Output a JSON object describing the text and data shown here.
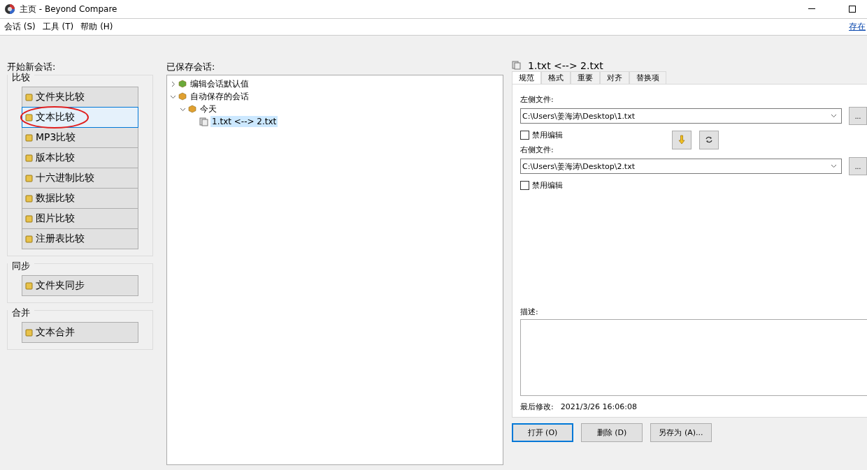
{
  "window": {
    "title": "主页 - Beyond Compare"
  },
  "menu": {
    "items": [
      {
        "label": "会话 (S)"
      },
      {
        "label": "工具 (T)"
      },
      {
        "label": "帮助 (H)"
      }
    ],
    "link": "存在"
  },
  "new_session": {
    "heading": "开始新会话:",
    "groups": [
      {
        "title": "比较",
        "buttons": [
          {
            "label": "文件夹比较",
            "selected": false,
            "circled": false
          },
          {
            "label": "文本比较",
            "selected": true,
            "circled": true
          },
          {
            "label": "MP3比较",
            "selected": false,
            "circled": false
          },
          {
            "label": "版本比较",
            "selected": false,
            "circled": false
          },
          {
            "label": "十六进制比较",
            "selected": false,
            "circled": false
          },
          {
            "label": "数据比较",
            "selected": false,
            "circled": false
          },
          {
            "label": "图片比较",
            "selected": false,
            "circled": false
          },
          {
            "label": "注册表比较",
            "selected": false,
            "circled": false
          }
        ]
      },
      {
        "title": "同步",
        "buttons": [
          {
            "label": "文件夹同步",
            "selected": false,
            "circled": false
          }
        ]
      },
      {
        "title": "合并",
        "buttons": [
          {
            "label": "文本合并",
            "selected": false,
            "circled": false
          }
        ]
      }
    ]
  },
  "saved_sessions": {
    "heading": "已保存会话:",
    "tree": [
      {
        "label": "编辑会话默认值",
        "kind": "defaults",
        "expanded": false,
        "selected": false
      },
      {
        "label": "自动保存的会话",
        "kind": "folder",
        "expanded": true,
        "selected": false,
        "children": [
          {
            "label": "今天",
            "kind": "folder",
            "expanded": true,
            "selected": false,
            "children": [
              {
                "label": "1.txt <--> 2.txt",
                "kind": "session",
                "selected": true
              }
            ]
          }
        ]
      }
    ]
  },
  "details": {
    "title": "1.txt <--> 2.txt",
    "tabs": [
      {
        "label": "规范",
        "selected": true
      },
      {
        "label": "格式",
        "selected": false
      },
      {
        "label": "重要",
        "selected": false
      },
      {
        "label": "对齐",
        "selected": false
      },
      {
        "label": "替换项",
        "selected": false
      }
    ],
    "left_file": {
      "label": "左侧文件:",
      "value": "C:\\Users\\姜海涛\\Desktop\\1.txt",
      "disable_label": "禁用编辑",
      "disable_checked": false,
      "browse": "..."
    },
    "right_file": {
      "label": "右侧文件:",
      "value": "C:\\Users\\姜海涛\\Desktop\\2.txt",
      "disable_label": "禁用编辑",
      "disable_checked": false,
      "browse": "..."
    },
    "description_label": "描述:",
    "last_modified_label": "最后修改:",
    "last_modified": "2021/3/26 16:06:08",
    "buttons": [
      {
        "label": "打开 (O)",
        "focused": true
      },
      {
        "label": "删除 (D)",
        "focused": false
      },
      {
        "label": "另存为 (A)...",
        "focused": false
      }
    ]
  }
}
